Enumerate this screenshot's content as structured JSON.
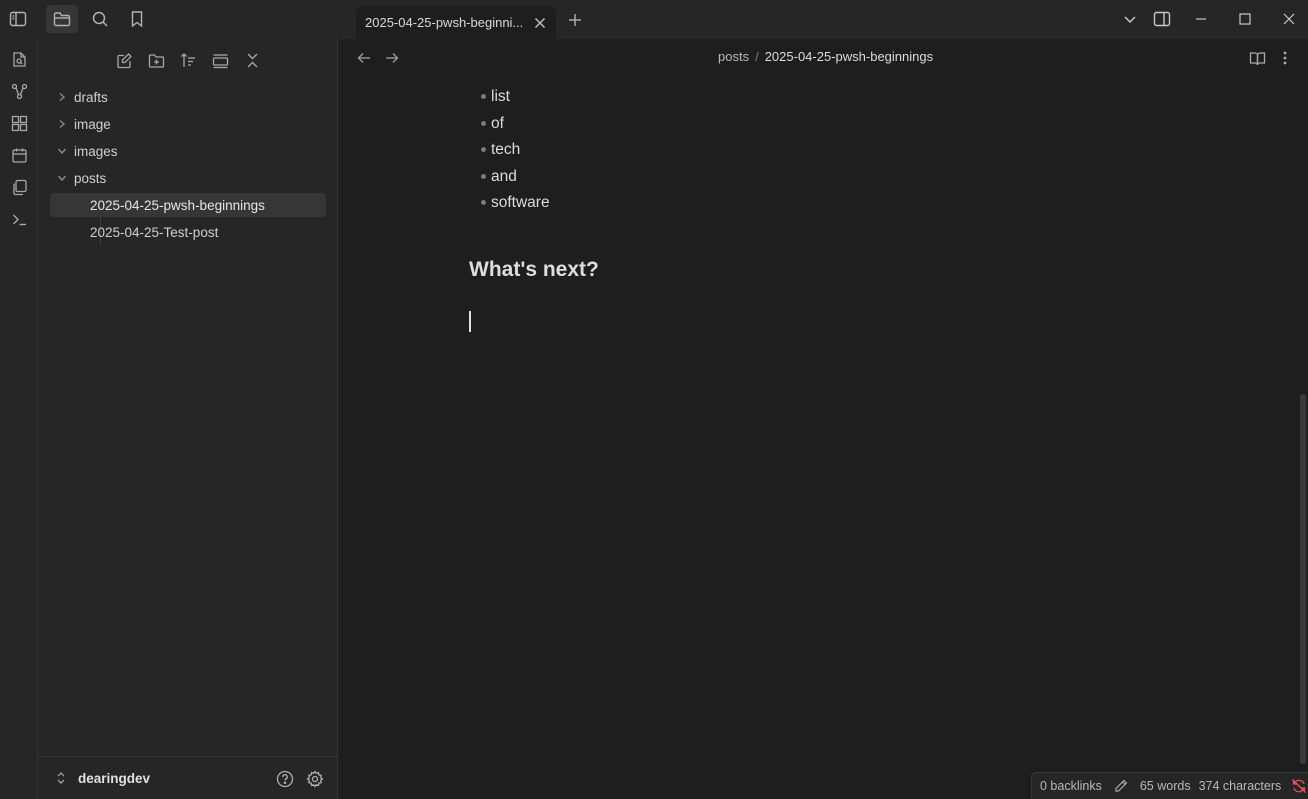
{
  "titlebar": {
    "tab_title": "2025-04-25-pwsh-beginni...",
    "sidebar_toggle_icon": "sidebar-left-icon",
    "files_icon": "folder-icon",
    "search_icon": "search-icon",
    "bookmarks_icon": "bookmark-icon"
  },
  "ribbon": {
    "items": [
      "open-quick-switcher-icon",
      "graph-view-icon",
      "canvas-icon",
      "daily-note-icon",
      "templates-icon",
      "terminal-icon"
    ]
  },
  "sidebar": {
    "tree": [
      {
        "label": "drafts",
        "type": "folder",
        "expanded": false
      },
      {
        "label": "image",
        "type": "folder",
        "expanded": false
      },
      {
        "label": "images",
        "type": "folder",
        "expanded": true
      },
      {
        "label": "posts",
        "type": "folder",
        "expanded": true
      },
      {
        "label": "2025-04-25-pwsh-beginnings",
        "type": "file",
        "selected": true
      },
      {
        "label": "2025-04-25-Test-post",
        "type": "file",
        "selected": false
      }
    ],
    "vault_name": "dearingdev"
  },
  "breadcrumb": {
    "folder": "posts",
    "separator": "/",
    "file": "2025-04-25-pwsh-beginnings"
  },
  "editor": {
    "bullets": [
      "list",
      "of",
      "tech",
      "and",
      "software"
    ],
    "heading": "What's next?"
  },
  "status": {
    "backlinks": "0 backlinks",
    "words": "65 words",
    "characters": "374 characters"
  }
}
